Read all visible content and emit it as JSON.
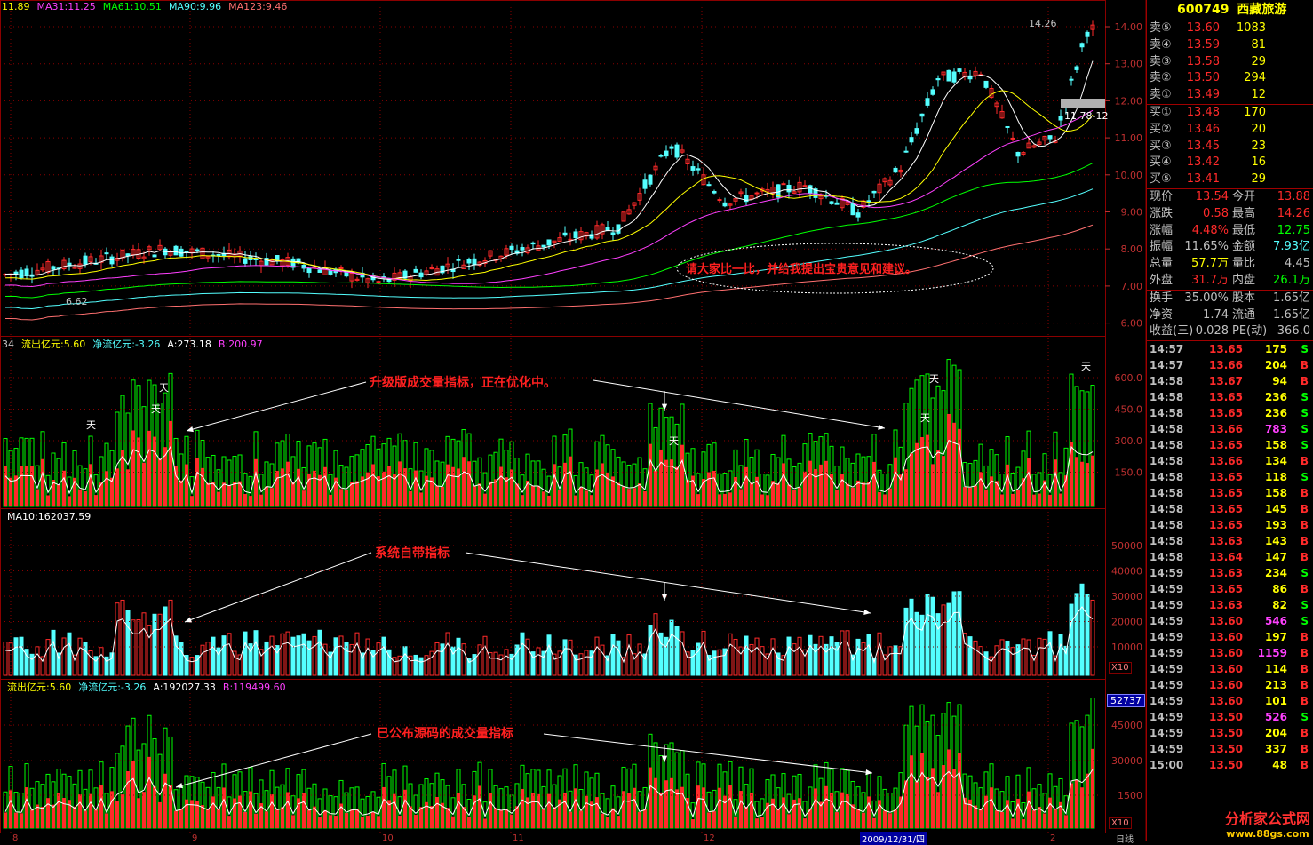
{
  "colors": {
    "red": "#ff2a2a",
    "cyan": "#54ffff",
    "green": "#00ff00",
    "grid": "#8b0000",
    "yellow": "#ffff00",
    "magenta": "#ff40ff",
    "white": "#ffffff"
  },
  "main_header": [
    {
      "text": "11.89",
      "color": "#ffff00"
    },
    {
      "text": "MA31:11.25",
      "color": "#ff40ff"
    },
    {
      "text": "MA61:10.51",
      "color": "#00ff00"
    },
    {
      "text": "MA90:9.96",
      "color": "#54ffff"
    },
    {
      "text": "MA123:9.46",
      "color": "#ff7070"
    }
  ],
  "vol1_header": [
    {
      "text": "34",
      "color": "#c0c0c0"
    },
    {
      "text": "流出亿元:5.60",
      "color": "#ffff00"
    },
    {
      "text": "净流亿元:-3.26",
      "color": "#54ffff"
    },
    {
      "text": "A:273.18",
      "color": "#ffffff"
    },
    {
      "text": "B:200.97",
      "color": "#ff40ff"
    }
  ],
  "vol2_header": [
    {
      "text": "MA10:162037.59",
      "color": "#ffffff"
    }
  ],
  "vol3_header": [
    {
      "text": "流出亿元:5.60",
      "color": "#ffff00"
    },
    {
      "text": "净流亿元:-3.26",
      "color": "#54ffff"
    },
    {
      "text": "A:192027.33",
      "color": "#ffffff"
    },
    {
      "text": "B:119499.60",
      "color": "#ff40ff"
    }
  ],
  "annotations": {
    "compare_note": "请大家比一比，并给我提出宝贵意见和建议。",
    "upgraded_indicator": "升级版成交量指标，正在优化中。",
    "system_indicator": "系统自带指标",
    "published_indicator": "已公布源码的成交量指标",
    "price_high_label": "14.26",
    "price_low_label": "6.62",
    "current_marker_label": "11.78-12",
    "box_value": "52737",
    "x10_label": "X10",
    "date_label": "2009/12/31/四",
    "period_label": "日线",
    "tian_label": "天"
  },
  "axes": {
    "price": [
      "14.00",
      "13.00",
      "12.00",
      "11.00",
      "10.00",
      "9.00",
      "8.00",
      "7.00",
      "6.00"
    ],
    "vol1": [
      "600.0",
      "450.0",
      "300.0",
      "150.0"
    ],
    "vol2": [
      "50000",
      "40000",
      "30000",
      "20000",
      "10000"
    ],
    "vol3": [
      "45000",
      "30000",
      "1500"
    ],
    "months": [
      "8",
      "9",
      "10",
      "11",
      "12",
      "2"
    ]
  },
  "quote": {
    "code": "600749",
    "name": "西藏旅游",
    "asks": [
      {
        "label": "卖⑤",
        "price": "13.60",
        "vol": "1083"
      },
      {
        "label": "卖④",
        "price": "13.59",
        "vol": "81"
      },
      {
        "label": "卖③",
        "price": "13.58",
        "vol": "29"
      },
      {
        "label": "卖②",
        "price": "13.50",
        "vol": "294"
      },
      {
        "label": "卖①",
        "price": "13.49",
        "vol": "12"
      }
    ],
    "bids": [
      {
        "label": "买①",
        "price": "13.48",
        "vol": "170"
      },
      {
        "label": "买②",
        "price": "13.46",
        "vol": "20"
      },
      {
        "label": "买③",
        "price": "13.45",
        "vol": "23"
      },
      {
        "label": "买④",
        "price": "13.42",
        "vol": "16"
      },
      {
        "label": "买⑤",
        "price": "13.41",
        "vol": "29"
      }
    ],
    "stats1": [
      {
        "l1": "现价",
        "v1": "13.54",
        "c1": "#ff2a2a",
        "l2": "今开",
        "v2": "13.88",
        "c2": "#ff2a2a"
      },
      {
        "l1": "涨跌",
        "v1": "0.58",
        "c1": "#ff2a2a",
        "l2": "最高",
        "v2": "14.26",
        "c2": "#ff2a2a"
      },
      {
        "l1": "涨幅",
        "v1": "4.48%",
        "c1": "#ff2a2a",
        "l2": "最低",
        "v2": "12.75",
        "c2": "#00ff00"
      },
      {
        "l1": "振幅",
        "v1": "11.65%",
        "c1": "#c0c0c0",
        "l2": "金额",
        "v2": "7.93亿",
        "c2": "#54ffff"
      },
      {
        "l1": "总量",
        "v1": "57.7万",
        "c1": "#ffff00",
        "l2": "量比",
        "v2": "4.45",
        "c2": "#c0c0c0"
      },
      {
        "l1": "外盘",
        "v1": "31.7万",
        "c1": "#ff2a2a",
        "l2": "内盘",
        "v2": "26.1万",
        "c2": "#00ff00"
      }
    ],
    "stats2": [
      {
        "l1": "换手",
        "v1": "35.00%",
        "l2": "股本",
        "v2": "1.65亿"
      },
      {
        "l1": "净资",
        "v1": "1.74",
        "l2": "流通",
        "v2": "1.65亿"
      },
      {
        "l1": "收益(三)",
        "v1": "0.028",
        "l2": "PE(动)",
        "v2": "366.0"
      }
    ]
  },
  "ticks": [
    {
      "t": "14:57",
      "p": "13.65",
      "pc": "#ff2a2a",
      "v": "175",
      "vc": "#ffff00",
      "bs": "S",
      "bc": "#00ff00"
    },
    {
      "t": "14:57",
      "p": "13.66",
      "pc": "#ff2a2a",
      "v": "204",
      "vc": "#ffff00",
      "bs": "B",
      "bc": "#ff2a2a"
    },
    {
      "t": "14:58",
      "p": "13.67",
      "pc": "#ff2a2a",
      "v": "94",
      "vc": "#ffff00",
      "bs": "B",
      "bc": "#ff2a2a"
    },
    {
      "t": "14:58",
      "p": "13.65",
      "pc": "#ff2a2a",
      "v": "236",
      "vc": "#ffff00",
      "bs": "S",
      "bc": "#00ff00"
    },
    {
      "t": "14:58",
      "p": "13.65",
      "pc": "#ff2a2a",
      "v": "236",
      "vc": "#ffff00",
      "bs": "S",
      "bc": "#00ff00"
    },
    {
      "t": "14:58",
      "p": "13.66",
      "pc": "#ff2a2a",
      "v": "783",
      "vc": "#ff40ff",
      "bs": "S",
      "bc": "#00ff00"
    },
    {
      "t": "14:58",
      "p": "13.65",
      "pc": "#ff2a2a",
      "v": "158",
      "vc": "#ffff00",
      "bs": "S",
      "bc": "#00ff00"
    },
    {
      "t": "14:58",
      "p": "13.66",
      "pc": "#ff2a2a",
      "v": "134",
      "vc": "#ffff00",
      "bs": "B",
      "bc": "#ff2a2a"
    },
    {
      "t": "14:58",
      "p": "13.65",
      "pc": "#ff2a2a",
      "v": "118",
      "vc": "#ffff00",
      "bs": "S",
      "bc": "#00ff00"
    },
    {
      "t": "14:58",
      "p": "13.65",
      "pc": "#ff2a2a",
      "v": "158",
      "vc": "#ffff00",
      "bs": "B",
      "bc": "#ff2a2a"
    },
    {
      "t": "14:58",
      "p": "13.65",
      "pc": "#ff2a2a",
      "v": "145",
      "vc": "#ffff00",
      "bs": "B",
      "bc": "#ff2a2a"
    },
    {
      "t": "14:58",
      "p": "13.65",
      "pc": "#ff2a2a",
      "v": "193",
      "vc": "#ffff00",
      "bs": "B",
      "bc": "#ff2a2a"
    },
    {
      "t": "14:58",
      "p": "13.63",
      "pc": "#ff2a2a",
      "v": "143",
      "vc": "#ffff00",
      "bs": "B",
      "bc": "#ff2a2a"
    },
    {
      "t": "14:58",
      "p": "13.64",
      "pc": "#ff2a2a",
      "v": "147",
      "vc": "#ffff00",
      "bs": "B",
      "bc": "#ff2a2a"
    },
    {
      "t": "14:59",
      "p": "13.63",
      "pc": "#ff2a2a",
      "v": "234",
      "vc": "#ffff00",
      "bs": "S",
      "bc": "#00ff00"
    },
    {
      "t": "14:59",
      "p": "13.65",
      "pc": "#ff2a2a",
      "v": "86",
      "vc": "#ffff00",
      "bs": "B",
      "bc": "#ff2a2a"
    },
    {
      "t": "14:59",
      "p": "13.63",
      "pc": "#ff2a2a",
      "v": "82",
      "vc": "#ffff00",
      "bs": "S",
      "bc": "#00ff00"
    },
    {
      "t": "14:59",
      "p": "13.60",
      "pc": "#ff2a2a",
      "v": "546",
      "vc": "#ff40ff",
      "bs": "S",
      "bc": "#00ff00"
    },
    {
      "t": "14:59",
      "p": "13.60",
      "pc": "#ff2a2a",
      "v": "197",
      "vc": "#ffff00",
      "bs": "B",
      "bc": "#ff2a2a"
    },
    {
      "t": "14:59",
      "p": "13.60",
      "pc": "#ff2a2a",
      "v": "1159",
      "vc": "#ff40ff",
      "bs": "B",
      "bc": "#ff2a2a"
    },
    {
      "t": "14:59",
      "p": "13.60",
      "pc": "#ff2a2a",
      "v": "114",
      "vc": "#ffff00",
      "bs": "B",
      "bc": "#ff2a2a"
    },
    {
      "t": "14:59",
      "p": "13.60",
      "pc": "#ff2a2a",
      "v": "213",
      "vc": "#ffff00",
      "bs": "B",
      "bc": "#ff2a2a"
    },
    {
      "t": "14:59",
      "p": "13.60",
      "pc": "#ff2a2a",
      "v": "101",
      "vc": "#ffff00",
      "bs": "B",
      "bc": "#ff2a2a"
    },
    {
      "t": "14:59",
      "p": "13.50",
      "pc": "#ff2a2a",
      "v": "526",
      "vc": "#ff40ff",
      "bs": "S",
      "bc": "#00ff00"
    },
    {
      "t": "14:59",
      "p": "13.50",
      "pc": "#ff2a2a",
      "v": "204",
      "vc": "#ffff00",
      "bs": "B",
      "bc": "#ff2a2a"
    },
    {
      "t": "14:59",
      "p": "13.50",
      "pc": "#ff2a2a",
      "v": "337",
      "vc": "#ffff00",
      "bs": "B",
      "bc": "#ff2a2a"
    },
    {
      "t": "15:00",
      "p": "13.50",
      "pc": "#ff2a2a",
      "v": "48",
      "vc": "#ffff00",
      "bs": "B",
      "bc": "#ff2a2a"
    }
  ],
  "watermark": {
    "title": "分析家公式网",
    "url": "www.88gs.com"
  }
}
